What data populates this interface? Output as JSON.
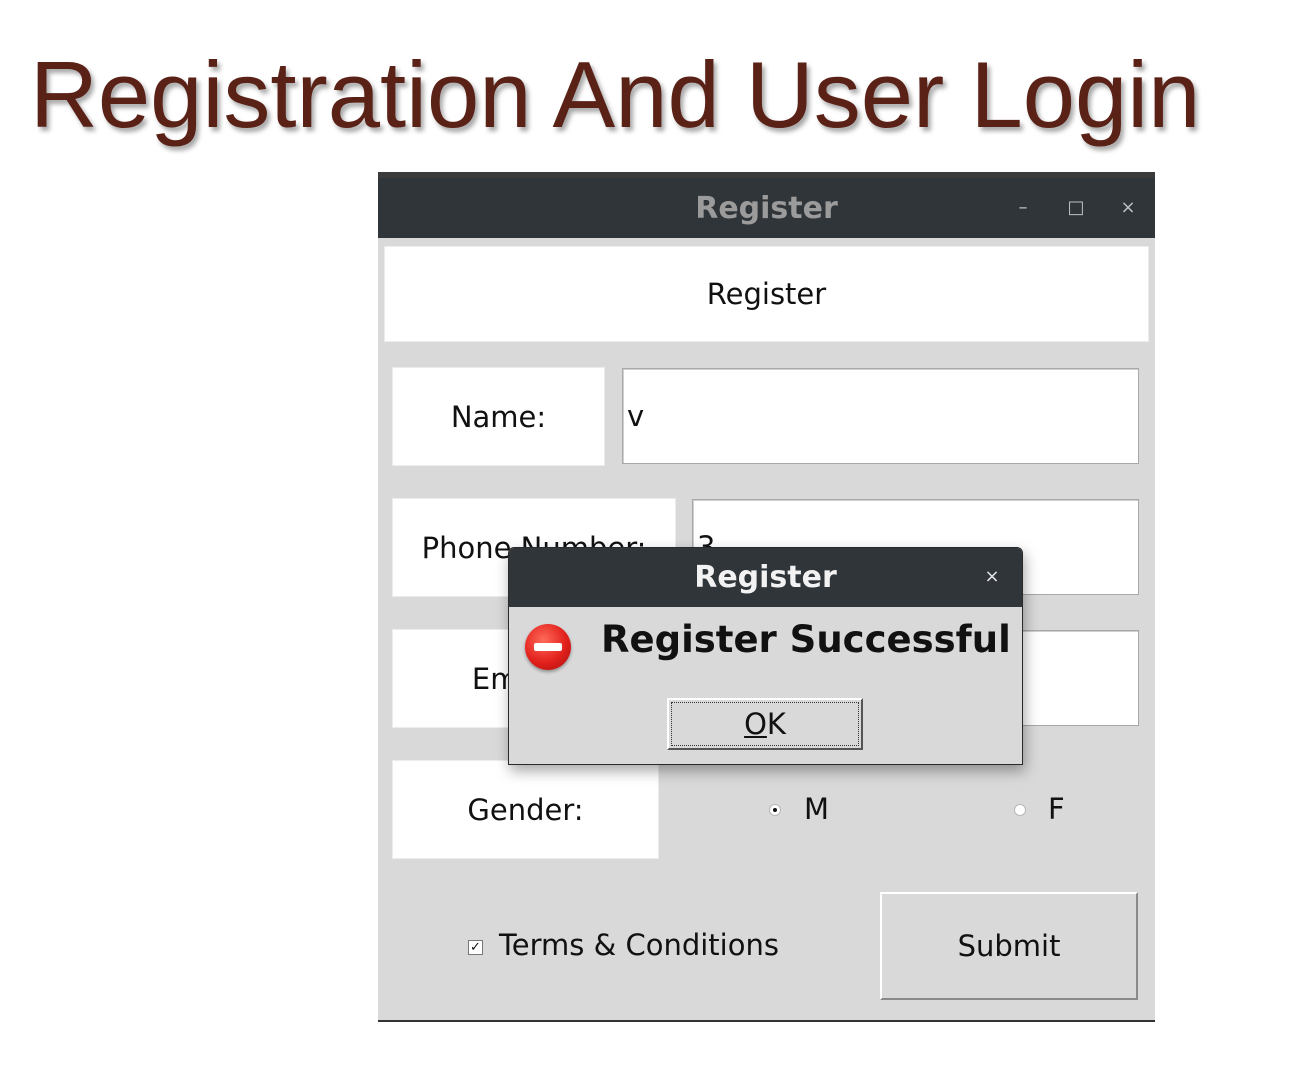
{
  "slide_title": "Registration And User Login",
  "window": {
    "title": "Register",
    "minimize_glyph": "–",
    "maximize_glyph": "□",
    "close_glyph": "×"
  },
  "form": {
    "header": "Register",
    "name_label": "Name:",
    "name_value": "v",
    "phone_label": "Phone Number:",
    "phone_value": "3",
    "email_label": "Email:",
    "gender_label": "Gender:",
    "gender_options": [
      {
        "label": "M",
        "selected": true
      },
      {
        "label": "F",
        "selected": false
      }
    ],
    "terms_label": "Terms & Conditions",
    "terms_checked": true,
    "submit_label": "Submit"
  },
  "dialog": {
    "title": "Register",
    "close_glyph": "×",
    "icon": "error-icon",
    "message": "Register Successful",
    "ok_mnemonic": "O",
    "ok_rest": "K"
  },
  "colors": {
    "title_text": "#5a2117",
    "titlebar": "#30353a",
    "window_bg": "#d9d9d9",
    "error_red": "#e2211c"
  }
}
